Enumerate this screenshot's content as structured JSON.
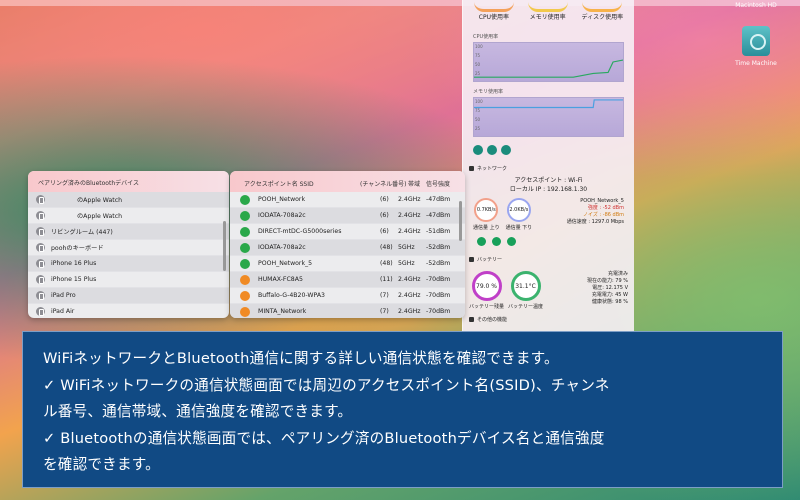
{
  "desktop": {
    "disk_label": "Macintosh HD",
    "timemachine_label": "Time Machine"
  },
  "monitor": {
    "gauges": [
      {
        "label": "CPU使用率"
      },
      {
        "label": "メモリ使用率"
      },
      {
        "label": "ディスク使用率"
      }
    ],
    "cpu_graph_label": "CPU使用率",
    "mem_graph_label": "メモリ使用率",
    "graph_ticks": [
      "100",
      "75",
      "50",
      "25"
    ],
    "network_header": "ネットワーク",
    "access_point": "アクセスポイント : Wi-Fi",
    "local_ip": "ローカル IP : 192.168.1.30",
    "upload_value": "0.7KB/s",
    "download_value": "2.0KB/s",
    "upload_label": "通信量 上り",
    "download_label": "通信量 下り",
    "ssid": "POOH_Network_5",
    "strength": "強度 : -52 dBm",
    "noise": "ノイズ : -86 dBm",
    "speed": "通信速度 : 1297.0 Mbps",
    "battery_header": "バッテリー",
    "battery_value": "79.0 %",
    "battery_label": "バッテリー残量",
    "temp_value": "31.1°C",
    "temp_label": "バッテリー温度",
    "charge_state": "充電済み",
    "capacity": "現在の能力: 79 %",
    "voltage": "電圧: 12.175 V",
    "charge_power": "充電電力: 45 W",
    "health": "健康状態: 98 %",
    "other_header": "その他の機能"
  },
  "bluetooth": {
    "header": "ペアリング済みのBluetoothデバイス",
    "devices": [
      "のApple Watch",
      "のApple Watch",
      "リビングルーム (447)",
      "poohのキーボード",
      "iPhone 16 Plus",
      "iPhone 15 Plus",
      "iPad Pro",
      "iPad Air"
    ]
  },
  "wifi": {
    "headers": {
      "ssid": "アクセスポイント名 SSID",
      "channel": "(チャンネル番号)",
      "band": "帯域",
      "strength": "信号強度"
    },
    "rows": [
      {
        "ssid": "POOH_Network",
        "channel": "(6)",
        "band": "2.4GHz",
        "strength": "-47dBm",
        "color": "#2aa84a"
      },
      {
        "ssid": "IODATA-708a2c",
        "channel": "(6)",
        "band": "2.4GHz",
        "strength": "-47dBm",
        "color": "#2aa84a"
      },
      {
        "ssid": "DIRECT-mtDC-G5000series",
        "channel": "(6)",
        "band": "2.4GHz",
        "strength": "-51dBm",
        "color": "#2aa84a"
      },
      {
        "ssid": "IODATA-708a2c",
        "channel": "(48)",
        "band": "5GHz",
        "strength": "-52dBm",
        "color": "#2aa84a"
      },
      {
        "ssid": "POOH_Network_5",
        "channel": "(48)",
        "band": "5GHz",
        "strength": "-52dBm",
        "color": "#2aa84a"
      },
      {
        "ssid": "HUMAX-FC8A5",
        "channel": "(11)",
        "band": "2.4GHz",
        "strength": "-70dBm",
        "color": "#f08a24"
      },
      {
        "ssid": "Buffalo-G-4B20-WPA3",
        "channel": "(7)",
        "band": "2.4GHz",
        "strength": "-70dBm",
        "color": "#f08a24"
      },
      {
        "ssid": "MINTA_Network",
        "channel": "(7)",
        "band": "2.4GHz",
        "strength": "-70dBm",
        "color": "#f08a24"
      }
    ]
  },
  "caption": {
    "line1": "WiFiネットワークとBluetooth通信に関する詳しい通信状態を確認できます。",
    "line2": "✓ WiFiネットワークの通信状態画面では周辺のアクセスポイント名(SSID)、チャンネ",
    "line3": "ル番号、通信帯域、通信強度を確認できます。",
    "line4": "✓ Bluetoothの通信状態画面では、ペアリング済のBluetoothデバイス名と通信強度",
    "line5": "を確認できます。"
  }
}
